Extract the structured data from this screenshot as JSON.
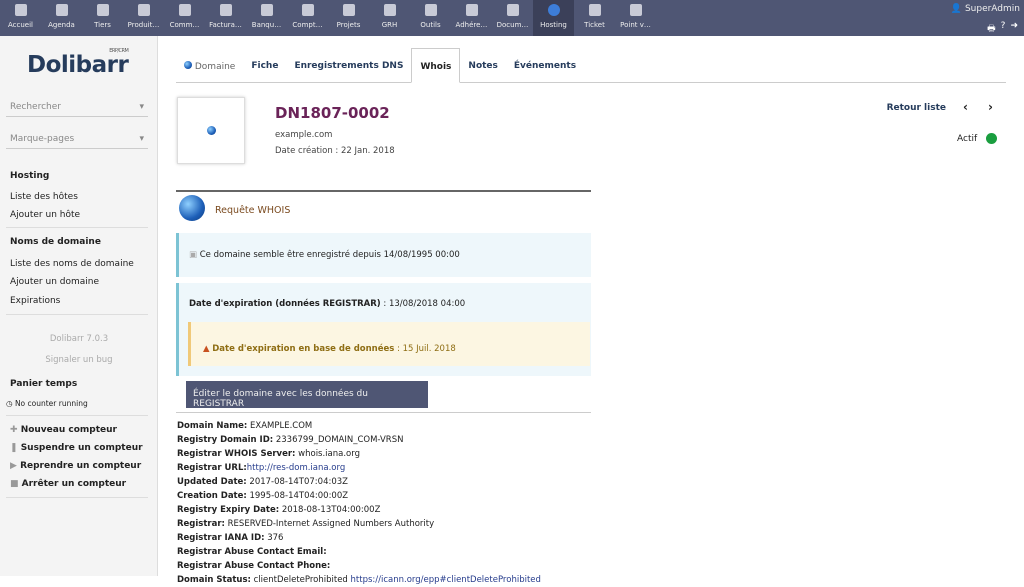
{
  "topmenu": [
    "Accueil",
    "Agenda",
    "Tiers",
    "Produit…",
    "Comm…",
    "Factura…",
    "Banqu…",
    "Compt…",
    "Projets",
    "GRH",
    "Outils",
    "Adhére…",
    "Docum…",
    "Hosting",
    "Ticket",
    "Point v…"
  ],
  "user": "SuperAdmin",
  "sidebar": {
    "logo": "Dolibarr",
    "logo_sub": "ERP/CRM",
    "search": "Rechercher",
    "bookmarks": "Marque-pages",
    "hosting": "Hosting",
    "hosts_list": "Liste des hôtes",
    "add_host": "Ajouter un hôte",
    "domains": "Noms de domaine",
    "domains_list": "Liste des noms de domaine",
    "add_domain": "Ajouter un domaine",
    "expirations": "Expirations",
    "version": "Dolibarr 7.0.3",
    "bug": "Signaler un bug",
    "timer": "Panier temps",
    "no_counter": "No counter running",
    "new_counter": "Nouveau compteur",
    "pause_counter": "Suspendre un compteur",
    "resume_counter": "Reprendre un compteur",
    "stop_counter": "Arrêter un compteur"
  },
  "tabs": [
    "Domaine",
    "Fiche",
    "Enregistrements DNS",
    "Whois",
    "Notes",
    "Événements"
  ],
  "record": {
    "ref": "DN1807-0002",
    "domain": "example.com",
    "created": "Date création : 22 Jan. 2018",
    "back": "Retour liste",
    "status": "Actif",
    "status_color": "#1a9e3f"
  },
  "whois": {
    "title": "Requête WHOIS",
    "registered": "Ce domaine semble être enregistré depuis 14/08/1995 00:00",
    "exp_label": "Date d'expiration (données REGISTRAR)",
    "exp_value": " : 13/08/2018 04:00",
    "db_label": "Date d'expiration en base de données",
    "db_value": " : 15 Juil. 2018",
    "button": "Éditer le domaine avec les données du REGISTRAR",
    "lines": [
      {
        "k": "Domain Name:",
        "v": " EXAMPLE.COM"
      },
      {
        "k": "Registry Domain ID:",
        "v": " 2336799_DOMAIN_COM-VRSN"
      },
      {
        "k": "Registrar WHOIS Server:",
        "v": " whois.iana.org"
      },
      {
        "k": "Registrar URL:",
        "v": "",
        "link": "http://res-dom.iana.org"
      },
      {
        "k": "Updated Date:",
        "v": " 2017-08-14T07:04:03Z"
      },
      {
        "k": "Creation Date:",
        "v": " 1995-08-14T04:00:00Z"
      },
      {
        "k": "Registry Expiry Date:",
        "v": " 2018-08-13T04:00:00Z"
      },
      {
        "k": "Registrar:",
        "v": " RESERVED-Internet Assigned Numbers Authority"
      },
      {
        "k": "Registrar IANA ID:",
        "v": " 376"
      },
      {
        "k": "Registrar Abuse Contact Email:",
        "v": ""
      },
      {
        "k": "Registrar Abuse Contact Phone:",
        "v": ""
      },
      {
        "k": "Domain Status:",
        "v": " clientDeleteProhibited ",
        "link": "https://icann.org/epp#clientDeleteProhibited"
      }
    ]
  }
}
